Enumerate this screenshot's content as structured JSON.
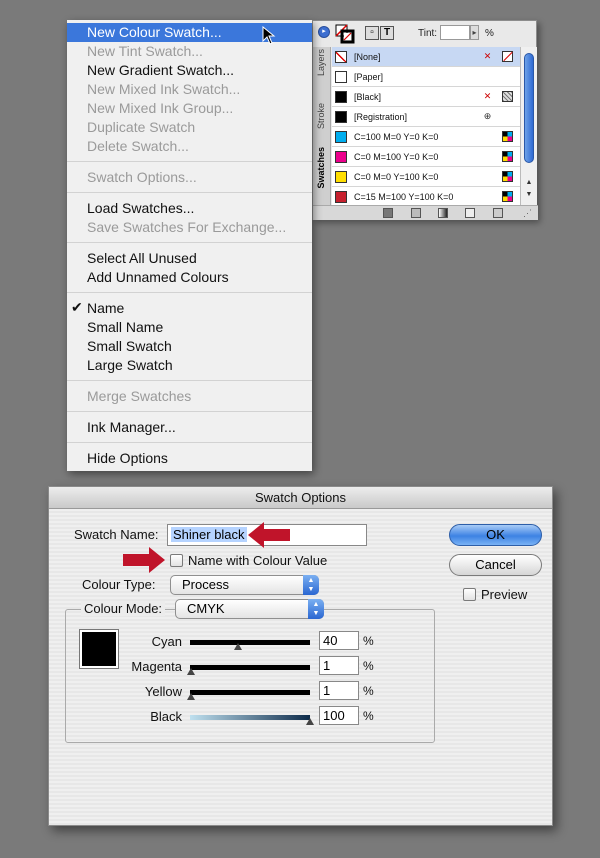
{
  "swatches_panel": {
    "tint_label": "Tint:",
    "tint_value": "",
    "tint_unit": "%",
    "tabs": [
      "Swatches",
      "Stroke",
      "Layers"
    ],
    "rows": [
      {
        "name": "[None]",
        "chip": "none",
        "selected": true
      },
      {
        "name": "[Paper]",
        "chip": "#ffffff",
        "selected": false
      },
      {
        "name": "[Black]",
        "chip": "#000000",
        "selected": false
      },
      {
        "name": "[Registration]",
        "chip": "#000000",
        "selected": false
      },
      {
        "name": "C=100 M=0 Y=0 K=0",
        "chip": "#00aeef",
        "selected": false
      },
      {
        "name": "C=0 M=100 Y=0 K=0",
        "chip": "#ec008c",
        "selected": false
      },
      {
        "name": "C=0 M=0 Y=100 K=0",
        "chip": "#ffde00",
        "selected": false
      },
      {
        "name": "C=15 M=100 Y=100 K=0",
        "chip": "#c7202e",
        "selected": false
      }
    ]
  },
  "menu": {
    "items": [
      {
        "label": "New Colour Swatch...",
        "disabled": false,
        "highlighted": true
      },
      {
        "label": "New Tint Swatch...",
        "disabled": true
      },
      {
        "label": "New Gradient Swatch...",
        "disabled": false
      },
      {
        "label": "New Mixed Ink Swatch...",
        "disabled": true
      },
      {
        "label": "New Mixed Ink Group...",
        "disabled": true
      },
      {
        "label": "Duplicate Swatch",
        "disabled": true
      },
      {
        "label": "Delete Swatch...",
        "disabled": true
      },
      {
        "label": "Swatch Options...",
        "disabled": true
      },
      {
        "label": "Load Swatches...",
        "disabled": false
      },
      {
        "label": "Save Swatches For Exchange...",
        "disabled": true
      },
      {
        "label": "Select All Unused",
        "disabled": false
      },
      {
        "label": "Add Unnamed Colours",
        "disabled": false
      },
      {
        "label": "Name",
        "disabled": false,
        "checked": true
      },
      {
        "label": "Small Name",
        "disabled": false
      },
      {
        "label": "Small Swatch",
        "disabled": false
      },
      {
        "label": "Large Swatch",
        "disabled": false
      },
      {
        "label": "Merge Swatches",
        "disabled": true
      },
      {
        "label": "Ink Manager...",
        "disabled": false
      },
      {
        "label": "Hide Options",
        "disabled": false
      }
    ],
    "check_mark": "✔"
  },
  "dialog": {
    "title": "Swatch Options",
    "swatch_name_label": "Swatch Name:",
    "swatch_name_value": "Shiner black",
    "name_with_colour_label": "Name with Colour Value",
    "name_with_colour_checked": false,
    "colour_type_label": "Colour Type:",
    "colour_type_value": "Process",
    "colour_mode_label": "Colour Mode:",
    "colour_mode_value": "CMYK",
    "ok_label": "OK",
    "cancel_label": "Cancel",
    "preview_label": "Preview",
    "preview_checked": false,
    "percent_symbol": "%",
    "sliders": [
      {
        "label": "Cyan",
        "value": "40",
        "level": 0.4
      },
      {
        "label": "Magenta",
        "value": "1",
        "level": 0.01
      },
      {
        "label": "Yellow",
        "value": "1",
        "level": 0.01
      },
      {
        "label": "Black",
        "value": "100",
        "level": 1.0
      }
    ],
    "swatch_color": "#000000"
  },
  "colors": {
    "highlight": "#3b77db",
    "annotation_arrow": "#c0142a"
  }
}
